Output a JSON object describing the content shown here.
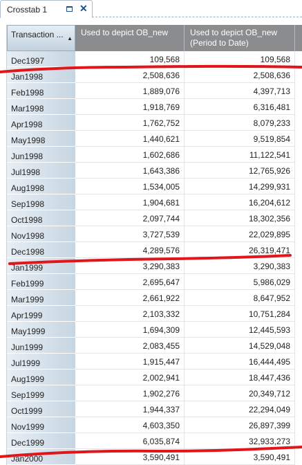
{
  "tab": {
    "title": "Crosstab 1",
    "maximize_icon": "maximize-icon",
    "close_icon": "close-icon",
    "close_glyph": "✕"
  },
  "header": {
    "dimension": "Transaction ...",
    "sort_glyph": "▲",
    "measure_1": "Used to depict OB_new",
    "measure_2_line1": "Used to depict OB_new",
    "measure_2_line2": "(Period to Date)"
  },
  "rows": [
    {
      "period": "Dec1997",
      "value": "109,568",
      "ptd": "109,568"
    },
    {
      "period": "Jan1998",
      "value": "2,508,636",
      "ptd": "2,508,636"
    },
    {
      "period": "Feb1998",
      "value": "1,889,076",
      "ptd": "4,397,713"
    },
    {
      "period": "Mar1998",
      "value": "1,918,769",
      "ptd": "6,316,481"
    },
    {
      "period": "Apr1998",
      "value": "1,762,752",
      "ptd": "8,079,233"
    },
    {
      "period": "May1998",
      "value": "1,440,621",
      "ptd": "9,519,854"
    },
    {
      "period": "Jun1998",
      "value": "1,602,686",
      "ptd": "11,122,541"
    },
    {
      "period": "Jul1998",
      "value": "1,643,386",
      "ptd": "12,765,926"
    },
    {
      "period": "Aug1998",
      "value": "1,534,005",
      "ptd": "14,299,931"
    },
    {
      "period": "Sep1998",
      "value": "1,904,681",
      "ptd": "16,204,612"
    },
    {
      "period": "Oct1998",
      "value": "2,097,744",
      "ptd": "18,302,356"
    },
    {
      "period": "Nov1998",
      "value": "3,727,539",
      "ptd": "22,029,895"
    },
    {
      "period": "Dec1998",
      "value": "4,289,576",
      "ptd": "26,319,471"
    },
    {
      "period": "Jan1999",
      "value": "3,290,383",
      "ptd": "3,290,383"
    },
    {
      "period": "Feb1999",
      "value": "2,695,647",
      "ptd": "5,986,029"
    },
    {
      "period": "Mar1999",
      "value": "2,661,922",
      "ptd": "8,647,952"
    },
    {
      "period": "Apr1999",
      "value": "2,103,332",
      "ptd": "10,751,284"
    },
    {
      "period": "May1999",
      "value": "1,694,309",
      "ptd": "12,445,593"
    },
    {
      "period": "Jun1999",
      "value": "2,083,455",
      "ptd": "14,529,048"
    },
    {
      "period": "Jul1999",
      "value": "1,915,447",
      "ptd": "16,444,495"
    },
    {
      "period": "Aug1999",
      "value": "2,002,941",
      "ptd": "18,447,436"
    },
    {
      "period": "Sep1999",
      "value": "1,902,276",
      "ptd": "20,349,712"
    },
    {
      "period": "Oct1999",
      "value": "1,944,337",
      "ptd": "22,294,049"
    },
    {
      "period": "Nov1999",
      "value": "4,603,350",
      "ptd": "26,897,399"
    },
    {
      "period": "Dec1999",
      "value": "6,035,874",
      "ptd": "32,933,273"
    },
    {
      "period": "Jan2000",
      "value": "3,590,491",
      "ptd": "3,590,491"
    }
  ],
  "annotation_color": "#e0161b"
}
